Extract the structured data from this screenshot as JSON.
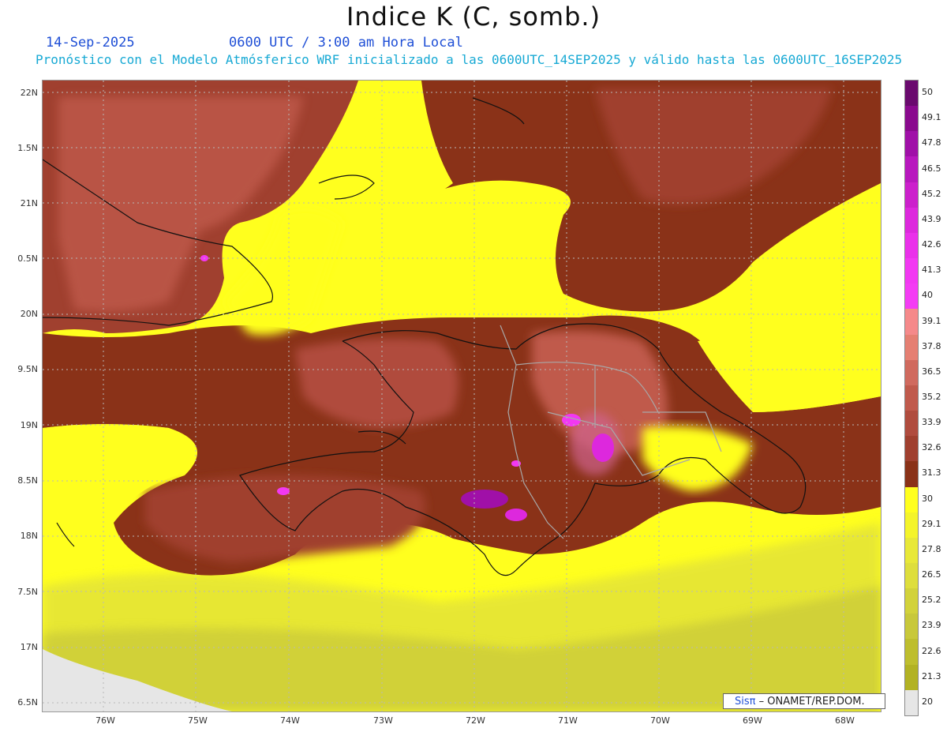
{
  "title": "Indice K (C, somb.)",
  "date": "14-Sep-2025",
  "time": "0600 UTC / 3:00 am Hora Local",
  "forecast": "Pronóstico con el Modelo Atmósferico WRF inicializado a las 0600UTC_14SEP2025 y válido hasta las  0600UTC_16SEP2025",
  "credit": {
    "logo": "Sisπ",
    "text": "– ONAMET/REP.DOM."
  },
  "lat_labels": [
    "22N",
    "1.5N",
    "21N",
    "0.5N",
    "20N",
    "9.5N",
    "19N",
    "8.5N",
    "18N",
    "7.5N",
    "17N",
    "6.5N"
  ],
  "lon_labels": [
    "76W",
    "75W",
    "74W",
    "73W",
    "72W",
    "71W",
    "70W",
    "69W",
    "68W"
  ],
  "colorbar": {
    "labels": [
      "50",
      "49.1",
      "47.8",
      "46.5",
      "45.2",
      "43.9",
      "42.6",
      "41.3",
      "40",
      "39.1",
      "37.8",
      "36.5",
      "35.2",
      "33.9",
      "32.6",
      "31.3",
      "30",
      "29.1",
      "27.8",
      "26.5",
      "25.2",
      "23.9",
      "22.6",
      "21.3",
      "20"
    ],
    "colors": [
      "#6a0a6e",
      "#8a0a8e",
      "#a010a8",
      "#b818be",
      "#cc20cc",
      "#dd28dd",
      "#ea30ea",
      "#f238f2",
      "#f43cf4",
      "#f5898a",
      "#e57f72",
      "#d06a5e",
      "#c05a4c",
      "#b04c3e",
      "#a0402f",
      "#8a3218",
      "#ffff1e",
      "#f4f42a",
      "#e8e838",
      "#dede3c",
      "#d2d23a",
      "#c8c83a",
      "#bebe2e",
      "#b2b224",
      "#e6e6e6"
    ]
  },
  "icons": {
    "logo": "sispi-logo"
  }
}
